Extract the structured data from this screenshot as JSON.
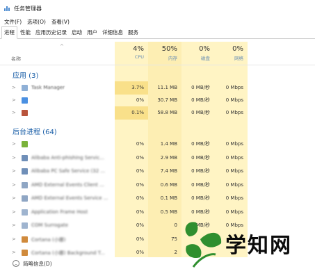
{
  "window": {
    "title": "任务管理器"
  },
  "menu": [
    "文件(F)",
    "选项(O)",
    "查看(V)"
  ],
  "tabs": [
    "进程",
    "性能",
    "应用历史记录",
    "启动",
    "用户",
    "详细信息",
    "服务"
  ],
  "active_tab": "进程",
  "columns": {
    "name": "名称",
    "cpu": {
      "pct": "4%",
      "label": "CPU"
    },
    "memory": {
      "pct": "50%",
      "label": "内存"
    },
    "disk": {
      "pct": "0%",
      "label": "磁盘"
    },
    "network": {
      "pct": "0%",
      "label": "网络"
    }
  },
  "groups": {
    "apps": "应用 (3)",
    "background": "后台进程 (64)"
  },
  "apps": [
    {
      "name": "Task Manager",
      "cpu": "3.7%",
      "mem": "11.1 MB",
      "disk": "0 MB/秒",
      "net": "0 Mbps"
    },
    {
      "name": "",
      "cpu": "0%",
      "mem": "30.7 MB",
      "disk": "0 MB/秒",
      "net": "0 Mbps"
    },
    {
      "name": "",
      "cpu": "0.1%",
      "mem": "58.8 MB",
      "disk": "0 MB/秒",
      "net": "0 Mbps"
    }
  ],
  "background": [
    {
      "name": "",
      "cpu": "0%",
      "mem": "1.4 MB",
      "disk": "0 MB/秒",
      "net": "0 Mbps"
    },
    {
      "name": "Alibaba Anti-phishing Servic...",
      "cpu": "0%",
      "mem": "2.9 MB",
      "disk": "0 MB/秒",
      "net": "0 Mbps"
    },
    {
      "name": "Alibaba PC Safe Service (32 ...",
      "cpu": "0%",
      "mem": "7.4 MB",
      "disk": "0 MB/秒",
      "net": "0 Mbps"
    },
    {
      "name": "AMD External Events Client ...",
      "cpu": "0%",
      "mem": "0.6 MB",
      "disk": "0 MB/秒",
      "net": "0 Mbps"
    },
    {
      "name": "AMD External Events Service ...",
      "cpu": "0%",
      "mem": "0.1 MB",
      "disk": "0 MB/秒",
      "net": "0 Mbps"
    },
    {
      "name": "Application Frame Host",
      "cpu": "0%",
      "mem": "0.5 MB",
      "disk": "0 MB/秒",
      "net": "0 Mbps"
    },
    {
      "name": "COM Surrogate",
      "cpu": "0%",
      "mem": "0",
      "disk": "0 MB/秒",
      "net": "0 Mbps"
    },
    {
      "name": "Cortana (小娜)",
      "cpu": "0%",
      "mem": "75",
      "disk": "",
      "net": ""
    },
    {
      "name": "Cortana (小娜) Background T...",
      "cpu": "0%",
      "mem": "2",
      "disk": "",
      "net": ""
    }
  ],
  "footer": {
    "label": "简略信息(D)"
  },
  "watermark": {
    "text": "学知网"
  },
  "colors": {
    "heat_light": "#fff4c4",
    "heat_mid": "#fde9a6",
    "heat_strong": "#f9e08a",
    "group_blue": "#1b5fa8",
    "watermark_green": "#2f8f2f"
  }
}
